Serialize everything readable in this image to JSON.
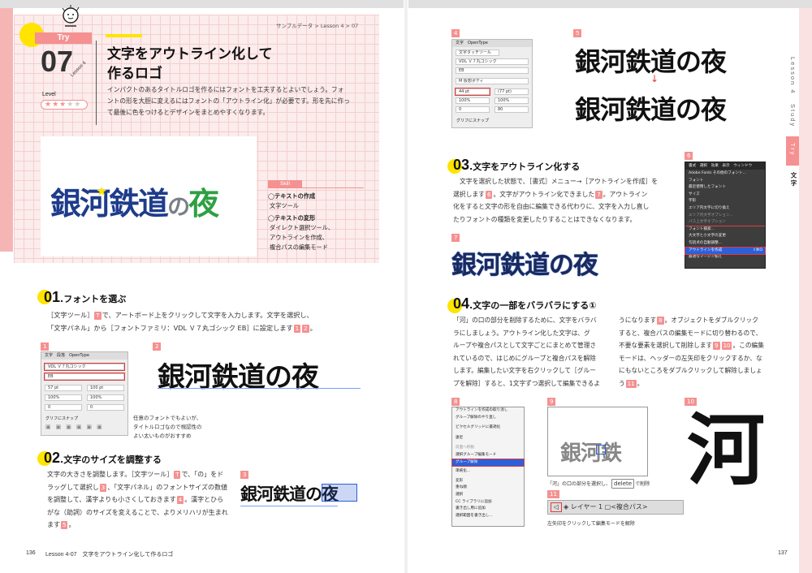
{
  "breadcrumb": "サンプルデータ > Lesson 4 > 07",
  "hero": {
    "try_label": "Try",
    "number": "07",
    "lesson_rot": "Lesson 4",
    "title_line1": "文字をアウトライン化して",
    "title_line2": "作るロゴ",
    "level_label": "Level",
    "level_filled": 3,
    "level_total": 5,
    "intro": [
      "インパクトのあるタイトルロゴを作るにはフォントを工夫するとよいでしょう。フォ",
      "ントの形を大胆に変えるにはフォントの「アウトライン化」が必要です。形を先に作っ",
      "て最後に色をつけるとデザインをまとめやすくなります。"
    ],
    "logo_text": [
      "銀",
      "河",
      "鉄",
      "道",
      "の",
      "夜"
    ],
    "skill_label": "Skill",
    "skill1_title": "◯テキストの作成",
    "skill1_sub": "文字ツール",
    "skill2_title": "◯テキストの変形",
    "skill2_sub1": "ダイレクト選択ツール、",
    "skill2_sub2": "アウトラインを作成、",
    "skill2_sub3": "複合パスの編集モード"
  },
  "s01": {
    "num": "01",
    "title": ".フォントを選ぶ",
    "lines": [
      "［文字ツール］",
      "で、アートボード上をクリックして文字を入力します。文字を選択し、",
      "「文字パネル」から［フォントファミリ：VDL Ｖ７丸ゴシック EB］に設定します"
    ],
    "fig1_badge": "1",
    "fig2_badge": "2",
    "fig2_text": "銀河鉄道の夜",
    "note": [
      "任意のフォントでもよいが、",
      "タイトルロゴなので視認性の",
      "よい太いものがおすすめ"
    ]
  },
  "panel1": {
    "tab1": "文字",
    "tab2": "段落",
    "tab3": "OpenType",
    "font": "VDL Ｖ７丸ゴシック",
    "weight": "EB",
    "size": "57 pt",
    "leading": "100 pt",
    "scale1": "100%",
    "scale2": "100%",
    "track1": "0",
    "track2": "0",
    "snap": "グリフにスナップ"
  },
  "s02": {
    "num": "02",
    "title": ".文字のサイズを調整する",
    "lines": [
      "文字の大きさを調整します。［文字ツール］",
      "で、「の」をド",
      "ラッグして選択し",
      "、「文字パネル」のフォントサイズの数値",
      "を調整して、漢字よりも小さくしておきます",
      "。漢字とひら",
      "がな（助詞）のサイズを変えることで、よりメリハリが生まれ",
      "ます"
    ],
    "fig3_badge": "3",
    "fig3_text": "銀河鉄道の夜"
  },
  "panel4": {
    "badge": "4",
    "tab1": "文字",
    "tab2": "OpenType",
    "btn": "文字タッチツール",
    "font": "VDL Ｖ７丸ゴシック",
    "weight": "EB",
    "style": "M 仮想ボディ",
    "size": "44 pt",
    "leading": "(77 pt)",
    "scale1": "100%",
    "scale2": "100%",
    "track1": "0",
    "track2": "80",
    "snap": "グリフにスナップ"
  },
  "fig5": {
    "badge": "5",
    "text1": "銀河鉄道の夜",
    "text2": "銀河鉄道の夜"
  },
  "s03": {
    "num": "03",
    "title": ".文字をアウトライン化する",
    "lines": [
      "文字を選択した状態で、［書式］メニュー→［アウトラインを作成］を",
      "選択します",
      "。文字がアウトライン化できました",
      "。アウトライン",
      "化をすると文字の形を自由に編集できる代わりに、文字を入力し直し",
      "たりフォントの種類を変更したりすることはできなくなります。"
    ],
    "fig7_badge": "7",
    "fig7_text": "銀河鉄道の夜"
  },
  "menu6": {
    "badge": "6",
    "bar": [
      "書式",
      "選択",
      "効果",
      "表示",
      "ウィンドウ"
    ],
    "items": [
      "Adobe Fonts その他のフォント...",
      "フォント",
      "最近使用したフォント",
      "サイズ",
      "字形",
      "エリア内文字に切り換え",
      "エリア内文字オプション...",
      "パス上文字オプション",
      "フォント検索...",
      "大文字と小文字の変更",
      "句読点の自動調整...",
      "アウトラインを作成",
      "最適なマージン揃え"
    ],
    "shortcut": "⇧⌘O"
  },
  "s04": {
    "num": "04",
    "title": ".文字の一部をバラバラにする①",
    "colA": [
      "「河」の口の部分を削除するために、文字をバラバ",
      "ラにしましょう。アウトライン化した文字は、グ",
      "ループや複合パスとして文字ごとにまとめて管理さ",
      "れているので、はじめにグループと複合パスを解除",
      "します。編集したい文字を右クリックして［グルー",
      "プを解除］すると、1文字ずつ選択して編集できるよ"
    ],
    "colB": [
      "うになります",
      "。オブジェクトをダブルクリック",
      "すると、複合パスの編集モードに切り替わるので、",
      "不要な要素を選択して削除します",
      "。この編集",
      "モードは、ヘッダーの左矢印をクリックするか、な",
      "にもないところをダブルクリックして解除しましょ",
      "う"
    ]
  },
  "menu8": {
    "badge": "8",
    "items": [
      "アウトラインを作成の取り消し",
      "グループ解除のやり直し",
      "ピクセルグリッドに最適化",
      "遠近",
      "前面へ移動",
      "選択グループ編集モード",
      "グループ解除",
      "単純化...",
      "変形",
      "重ね順",
      "選択",
      "CC ライブラリに追加",
      "書き出し用に追加",
      "選択範囲を書き出し..."
    ]
  },
  "fig9": {
    "badge": "9",
    "text": "銀河鉄",
    "cap": "「河」の口の部分を選択し、",
    "key": "delete",
    "cap2": "で削除"
  },
  "fig10": {
    "badge": "10",
    "text": "河"
  },
  "fig11": {
    "badge": "11",
    "layer": "レイヤー 1",
    "path": "<複合パス>",
    "cap": "左矢印をクリックして編集モードを解除"
  },
  "footer": {
    "left_num": "136",
    "left_text": "Lesson 4-07　文字をアウトライン化して作るロゴ",
    "right_num": "137"
  },
  "sidetab": {
    "lesson": "Lesson 4",
    "study": "Study",
    "try": "Try",
    "kanji": "文字"
  },
  "colors": {
    "pink": "#f59191",
    "yellow": "#ffe400",
    "navy": "#1e3c8c",
    "green": "#2ea043",
    "gray": "#7a7f85"
  }
}
